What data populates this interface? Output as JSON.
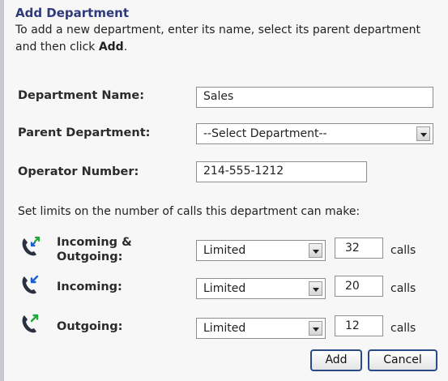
{
  "form": {
    "title": "Add Department",
    "description_prefix": "To add a new department, enter its name, select its parent department and then click ",
    "description_bold": "Add",
    "description_suffix": "."
  },
  "department_name": {
    "label": "Department Name:",
    "value": "Sales"
  },
  "parent_department": {
    "label": "Parent Department:",
    "selected": "--Select Department--"
  },
  "operator_number": {
    "label": "Operator Number:",
    "value": "214-555-1212"
  },
  "limits": {
    "intro": "Set limits on the number of calls this department can make:",
    "rows": [
      {
        "label_line1": "Incoming &",
        "label_line2": "Outgoing:",
        "mode": "Limited",
        "count": "32",
        "unit": "calls",
        "icon": "incoming-outgoing-phone-icon"
      },
      {
        "label_line1": "Incoming:",
        "label_line2": "",
        "mode": "Limited",
        "count": "20",
        "unit": "calls",
        "icon": "incoming-phone-icon"
      },
      {
        "label_line1": "Outgoing:",
        "label_line2": "",
        "mode": "Limited",
        "count": "12",
        "unit": "calls",
        "icon": "outgoing-phone-icon"
      }
    ]
  },
  "buttons": {
    "add": "Add",
    "cancel": "Cancel"
  },
  "colors": {
    "title": "#2f3a7a",
    "button_border": "#2a4a8a",
    "arrow_blue": "#1a5fd0",
    "arrow_green": "#1fa83a"
  }
}
